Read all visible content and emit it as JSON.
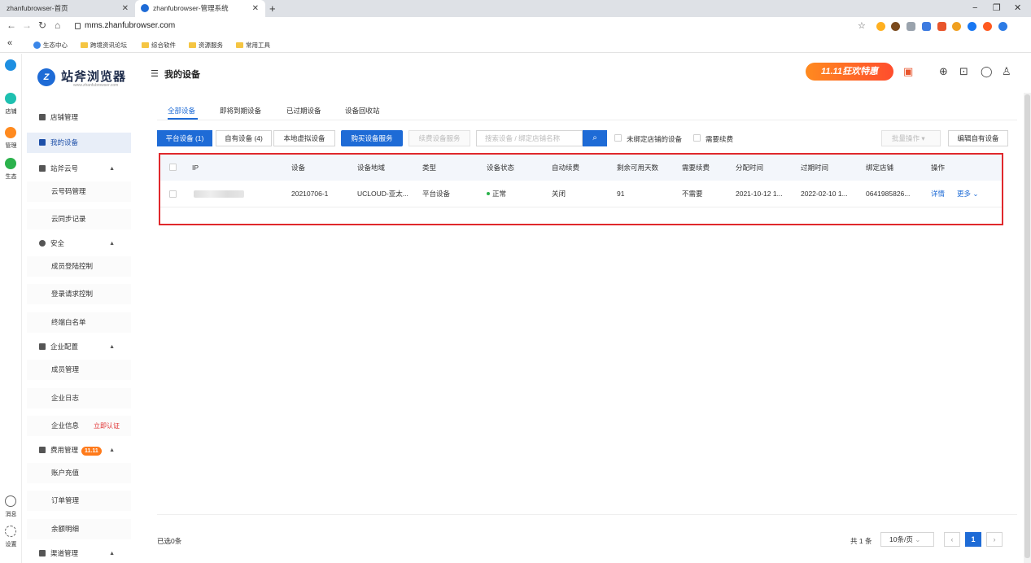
{
  "browser": {
    "tabs": [
      {
        "title": "zhanfubrowser-首页",
        "active": false
      },
      {
        "title": "zhanfubrowser-管理系统",
        "active": true
      }
    ],
    "new_tab": "+",
    "window_controls": [
      "−",
      "❐",
      "✕"
    ],
    "url": "mms.zhanfubrowser.com",
    "bookmarks": [
      "生态中心",
      "跨境资讯论坛",
      "综合软件",
      "资源服务",
      "常用工具"
    ]
  },
  "rail": {
    "items": [
      "店铺",
      "管理",
      "生态",
      "消息",
      "设置"
    ],
    "colors": {
      "store": "#1e8fe1",
      "manage": "#ff8a1f",
      "eco": "#2bb24c",
      "top": "#1e8fe1"
    }
  },
  "sidebar": {
    "logo_text": "站斧浏览器",
    "logo_sub": "www.zhanfubrowser.com",
    "logo_mark": "Z",
    "items": [
      {
        "label": "店铺管理"
      },
      {
        "label": "我的设备",
        "active": true
      },
      {
        "label": "站斧云号"
      },
      {
        "label": "云号码管理"
      },
      {
        "label": "云同步记录"
      },
      {
        "label": "安全"
      },
      {
        "label": "成员登陆控制"
      },
      {
        "label": "登录请求控制"
      },
      {
        "label": "终端白名单"
      },
      {
        "label": "企业配置"
      },
      {
        "label": "成员管理"
      },
      {
        "label": "企业日志"
      },
      {
        "label": "企业信息"
      },
      {
        "label": "费用管理"
      },
      {
        "label": "账户充值"
      },
      {
        "label": "订单管理"
      },
      {
        "label": "余额明细"
      },
      {
        "label": "渠道管理"
      }
    ],
    "verify_link": "立即认证",
    "promo_badge": "11.11"
  },
  "header": {
    "title": "我的设备",
    "promo": "11.11狂欢特惠"
  },
  "status_tabs": [
    "全部设备",
    "即将到期设备",
    "已过期设备",
    "设备回收站"
  ],
  "device_tabs": [
    "平台设备 (1)",
    "自有设备 (4)",
    "本地虚拟设备"
  ],
  "actions": {
    "buy": "购买设备服务",
    "renew": "续费设备服务",
    "search_placeholder": "搜索设备 / 绑定店铺名称",
    "unbound_label": "未绑定店铺的设备",
    "need_renew_label": "需要续费",
    "batch": "批量操作",
    "edit_own": "编辑自有设备"
  },
  "table": {
    "headers": [
      "IP",
      "设备",
      "设备地域",
      "类型",
      "设备状态",
      "自动续费",
      "剩余可用天数",
      "需要续费",
      "分配时间",
      "过期时间",
      "绑定店铺",
      "操作"
    ],
    "rows": [
      {
        "device": "20210706-1",
        "region": "UCLOUD-亚太...",
        "type": "平台设备",
        "status": "正常",
        "auto_renew": "关闭",
        "days_left": "91",
        "need_renew": "不需要",
        "assigned": "2021-10-12 1...",
        "expires": "2022-02-10 1...",
        "store": "0641985826...",
        "detail": "详情",
        "more": "更多"
      }
    ]
  },
  "footer": {
    "selected": "已选0条",
    "total": "共 1 条",
    "page_size": "10条/页",
    "current_page": "1"
  },
  "colors": {
    "primary": "#1e6bd6",
    "frame": "#e0282c",
    "status_ok": "#2bb24c",
    "promo": "#ff7a1a"
  }
}
